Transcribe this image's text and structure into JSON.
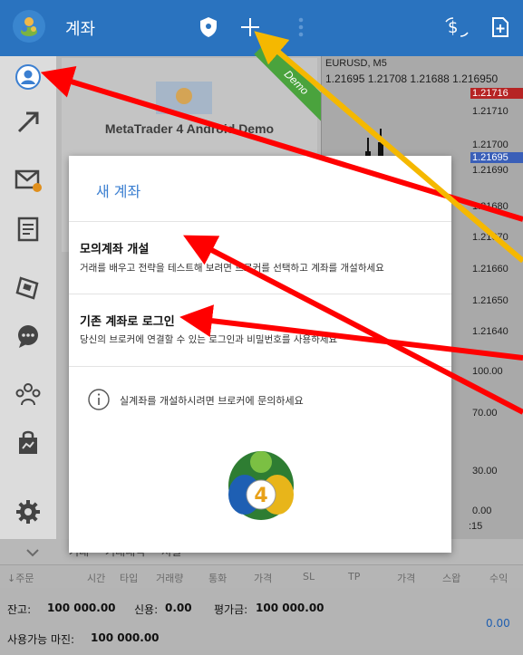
{
  "header": {
    "title": "계좌",
    "icons": [
      "app-logo-icon",
      "shield-icon",
      "plus-icon",
      "more-vertical-icon",
      "currency-icon",
      "export-icon"
    ]
  },
  "sidebar": {
    "items": [
      {
        "name": "account-icon"
      },
      {
        "name": "trade-icon"
      },
      {
        "name": "mail-icon",
        "badge": ""
      },
      {
        "name": "journal-icon"
      },
      {
        "name": "news-icon"
      },
      {
        "name": "chat-icon"
      },
      {
        "name": "community-icon"
      },
      {
        "name": "market-icon"
      },
      {
        "name": "settings-icon"
      }
    ]
  },
  "background": {
    "card_name": "MetaTrader 4 Android Demo",
    "ribbon": "Demo",
    "chart": {
      "symbol": "EURUSD, M5",
      "quote": "1.21695 1.21708 1.21688 1.216950",
      "prices": [
        "1.21716",
        "1.21710",
        "1.21700",
        "1.21695",
        "1.21690",
        "1.21680",
        "1.21670",
        "1.21660",
        "1.21650",
        "1.21640",
        "100.00",
        "70.00",
        "30.00",
        "0.00"
      ],
      "time": ":15"
    }
  },
  "bottom": {
    "tabs": [
      "거래",
      "거래내역",
      "저널"
    ],
    "columns": [
      "↓주문",
      "시간",
      "타입",
      "거래량",
      "통화",
      "가격",
      "SL",
      "TP",
      "가격",
      "스왑",
      "수익"
    ],
    "balance_label": "잔고:",
    "balance_value": "100 000.00",
    "credit_label": "신용:",
    "credit_value": "0.00",
    "equity_label": "평가금:",
    "equity_value": "100 000.00",
    "free_margin_label": "사용가능 마진:",
    "free_margin_value": "100 000.00",
    "profit_value": "0.00"
  },
  "dialog": {
    "title": "새 계좌",
    "options": [
      {
        "title": "모의계좌 개설",
        "description": "거래를 배우고 전략을 테스트해 보려면 브로커를 선택하고 계좌를 개설하세요"
      },
      {
        "title": "기존 계좌로 로그인",
        "description": "당신의 브로커에 연결할 수 있는 로그인과 비밀번호를 사용하세요"
      }
    ],
    "info": "실계좌를 개설하시려면 브로커에 문의하세요",
    "logo_text": "4"
  },
  "colors": {
    "topbar": "#2a73bf",
    "accent": "#3b7fd1",
    "ribbon": "#4aa33d",
    "annotation_red": "#ff0000",
    "annotation_yellow": "#f5b800"
  }
}
